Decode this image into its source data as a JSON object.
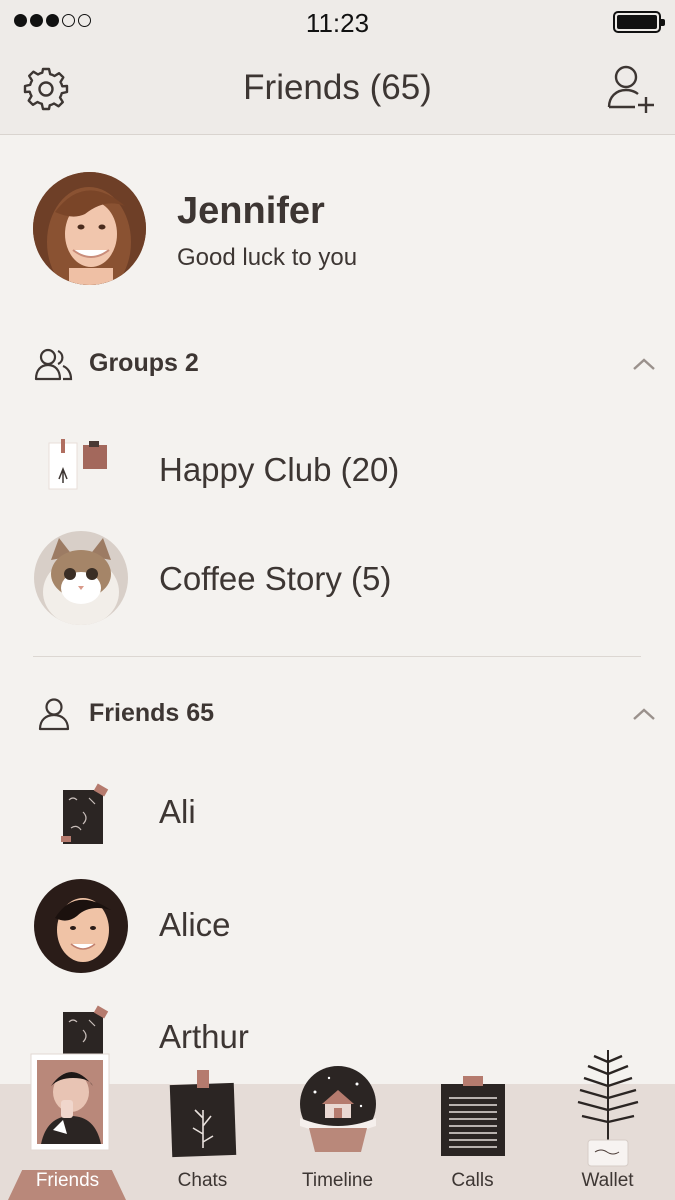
{
  "status_bar": {
    "time": "11:23",
    "signal_filled": 3,
    "signal_total": 5
  },
  "header": {
    "title": "Friends (65)",
    "left_icon": "gear-icon",
    "right_icon": "add-friend-icon"
  },
  "profile": {
    "name": "Jennifer",
    "status": "Good luck to you"
  },
  "groups": {
    "label": "Groups 2",
    "items": [
      {
        "label": "Happy Club (20)"
      },
      {
        "label": "Coffee Story (5)"
      }
    ]
  },
  "friends": {
    "label": "Friends 65",
    "items": [
      {
        "label": "Ali"
      },
      {
        "label": "Alice"
      },
      {
        "label": "Arthur"
      }
    ]
  },
  "tabs": [
    {
      "label": "Friends",
      "active": true
    },
    {
      "label": "Chats",
      "active": false
    },
    {
      "label": "Timeline",
      "active": false
    },
    {
      "label": "Calls",
      "active": false
    },
    {
      "label": "Wallet",
      "active": false
    }
  ],
  "colors": {
    "background": "#f4f2ef",
    "header": "#eeebe8",
    "tabbar": "#e5dcd7",
    "accent": "#b9887a",
    "text": "#3d3633"
  }
}
